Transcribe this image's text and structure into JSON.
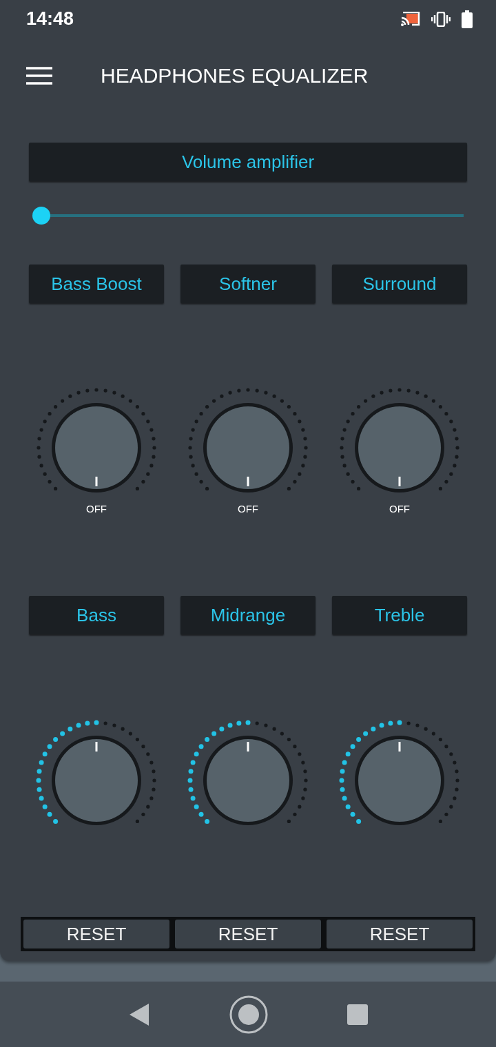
{
  "status_bar": {
    "time": "14:48"
  },
  "app_bar": {
    "title": "HEADPHONES EQUALIZER"
  },
  "volume": {
    "label": "Volume amplifier",
    "level": 0
  },
  "effects": [
    {
      "label": "Bass Boost",
      "level": 0,
      "reading": "OFF"
    },
    {
      "label": "Softner",
      "level": 0,
      "reading": "OFF"
    },
    {
      "label": "Surround",
      "level": 0,
      "reading": "OFF"
    }
  ],
  "tones": [
    {
      "label": "Bass",
      "level": 0.5
    },
    {
      "label": "Midrange",
      "level": 0.5
    },
    {
      "label": "Treble",
      "level": 0.5
    }
  ],
  "reset_buttons": [
    "RESET",
    "RESET",
    "RESET"
  ]
}
